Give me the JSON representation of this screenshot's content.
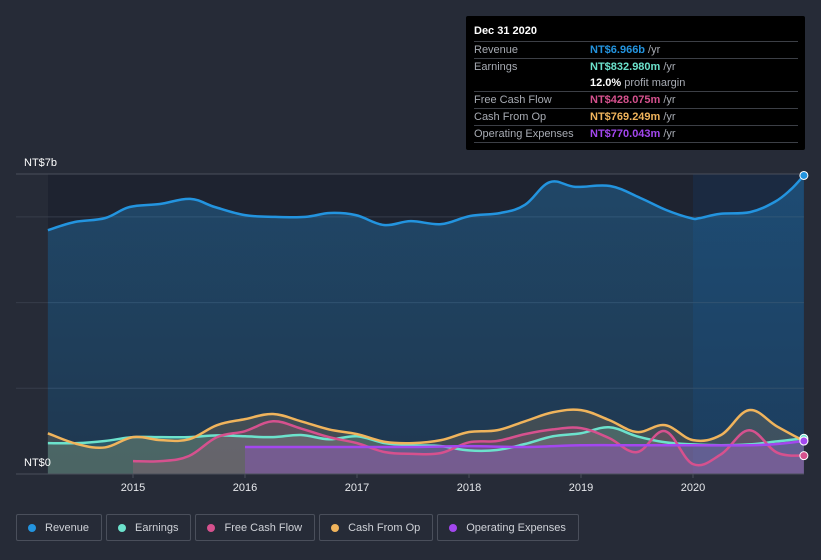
{
  "tooltip": {
    "date": "Dec 31 2020",
    "rows": [
      {
        "label": "Revenue",
        "value": "NT$6.966b",
        "unit": "/yr",
        "color": "#2394df"
      },
      {
        "label": "Earnings",
        "value": "NT$832.980m",
        "unit": "/yr",
        "color": "#6ce2cc"
      },
      {
        "label": "",
        "value": "12.0%",
        "unit": "profit margin",
        "color": "#ffffff"
      },
      {
        "label": "Free Cash Flow",
        "value": "NT$428.075m",
        "unit": "/yr",
        "color": "#d6518e"
      },
      {
        "label": "Cash From Op",
        "value": "NT$769.249m",
        "unit": "/yr",
        "color": "#f0b45c"
      },
      {
        "label": "Operating Expenses",
        "value": "NT$770.043m",
        "unit": "/yr",
        "color": "#a347ef"
      }
    ]
  },
  "legend": [
    {
      "label": "Revenue",
      "color": "#2394df"
    },
    {
      "label": "Earnings",
      "color": "#6ce2cc"
    },
    {
      "label": "Free Cash Flow",
      "color": "#d6518e"
    },
    {
      "label": "Cash From Op",
      "color": "#f0b45c"
    },
    {
      "label": "Operating Expenses",
      "color": "#a347ef"
    }
  ],
  "chart_data": {
    "type": "area",
    "title": "",
    "xlabel": "",
    "ylabel": "",
    "y_unit": "NT$ billions",
    "ylim": [
      0,
      7
    ],
    "xlim": [
      2014.25,
      2021.0
    ],
    "y_tick_labels": [
      "NT$0",
      "NT$7b"
    ],
    "y_tick_values": [
      0,
      7
    ],
    "gridlines_b": [
      2,
      4,
      6,
      7
    ],
    "x_tick_labels": [
      "2015",
      "2016",
      "2017",
      "2018",
      "2019",
      "2020"
    ],
    "x_tick_values": [
      2015,
      2016,
      2017,
      2018,
      2019,
      2020
    ],
    "highlight_from": 2020.0,
    "legend_position": "bottom",
    "series": [
      {
        "name": "Revenue",
        "color": "#2394df",
        "x": [
          2014.24,
          2014.48,
          2014.75,
          2014.97,
          2015.24,
          2015.51,
          2015.73,
          2016.0,
          2016.27,
          2016.54,
          2016.76,
          2016.99,
          2017.24,
          2017.48,
          2017.75,
          2018.01,
          2018.28,
          2018.5,
          2018.72,
          2018.95,
          2019.26,
          2019.53,
          2019.76,
          2019.98,
          2020.06,
          2020.24,
          2020.51,
          2020.73,
          2020.87,
          2020.99
        ],
        "values": [
          5.69,
          5.88,
          5.97,
          6.23,
          6.3,
          6.42,
          6.23,
          6.04,
          6.0,
          6.0,
          6.09,
          6.04,
          5.81,
          5.9,
          5.83,
          6.02,
          6.09,
          6.28,
          6.81,
          6.7,
          6.72,
          6.44,
          6.16,
          5.97,
          5.97,
          6.07,
          6.11,
          6.35,
          6.63,
          6.966
        ]
      },
      {
        "name": "Earnings",
        "color": "#6ce2cc",
        "x": [
          2014.24,
          2014.5,
          2014.75,
          2015.0,
          2015.25,
          2015.5,
          2015.75,
          2016.0,
          2016.25,
          2016.5,
          2016.75,
          2017.0,
          2017.25,
          2017.5,
          2017.75,
          2018.0,
          2018.25,
          2018.5,
          2018.75,
          2019.0,
          2019.25,
          2019.5,
          2019.75,
          2020.0,
          2020.25,
          2020.5,
          2020.75,
          2020.99
        ],
        "values": [
          0.72,
          0.72,
          0.77,
          0.86,
          0.86,
          0.86,
          0.9,
          0.88,
          0.86,
          0.91,
          0.81,
          0.88,
          0.72,
          0.67,
          0.65,
          0.55,
          0.56,
          0.7,
          0.88,
          0.95,
          1.09,
          0.88,
          0.74,
          0.69,
          0.67,
          0.69,
          0.76,
          0.833
        ]
      },
      {
        "name": "Free Cash Flow",
        "color": "#d6518e",
        "x": [
          2015.0,
          2015.25,
          2015.5,
          2015.75,
          2016.0,
          2016.25,
          2016.5,
          2016.75,
          2017.0,
          2017.25,
          2017.5,
          2017.75,
          2018.0,
          2018.25,
          2018.5,
          2018.75,
          2019.0,
          2019.25,
          2019.5,
          2019.75,
          2020.0,
          2020.25,
          2020.5,
          2020.75,
          2020.99
        ],
        "values": [
          0.3,
          0.3,
          0.42,
          0.86,
          1.0,
          1.23,
          1.06,
          0.86,
          0.72,
          0.51,
          0.47,
          0.49,
          0.74,
          0.77,
          0.93,
          1.04,
          1.07,
          0.84,
          0.51,
          1.0,
          0.23,
          0.46,
          1.02,
          0.5,
          0.428
        ]
      },
      {
        "name": "Cash From Op",
        "color": "#f0b45c",
        "x": [
          2014.24,
          2014.5,
          2014.75,
          2015.0,
          2015.25,
          2015.5,
          2015.75,
          2016.0,
          2016.25,
          2016.5,
          2016.75,
          2017.0,
          2017.25,
          2017.5,
          2017.75,
          2018.0,
          2018.25,
          2018.5,
          2018.75,
          2019.0,
          2019.25,
          2019.5,
          2019.75,
          2020.0,
          2020.25,
          2020.5,
          2020.75,
          2020.99
        ],
        "values": [
          0.95,
          0.7,
          0.62,
          0.86,
          0.79,
          0.81,
          1.14,
          1.28,
          1.4,
          1.23,
          1.04,
          0.93,
          0.75,
          0.72,
          0.79,
          0.98,
          1.02,
          1.23,
          1.44,
          1.49,
          1.26,
          0.98,
          1.14,
          0.79,
          0.91,
          1.49,
          1.11,
          0.769
        ]
      },
      {
        "name": "Operating Expenses",
        "color": "#a347ef",
        "x": [
          2016.0,
          2016.5,
          2017.0,
          2017.5,
          2018.0,
          2018.5,
          2019.0,
          2019.5,
          2020.0,
          2020.5,
          2020.75,
          2020.99
        ],
        "values": [
          0.63,
          0.63,
          0.63,
          0.63,
          0.65,
          0.63,
          0.67,
          0.67,
          0.67,
          0.67,
          0.7,
          0.77
        ]
      }
    ]
  }
}
